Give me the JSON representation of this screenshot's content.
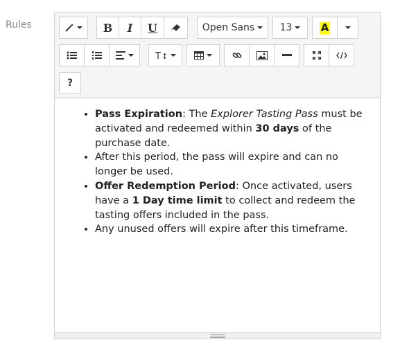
{
  "field": {
    "label": "Rules"
  },
  "toolbar": {
    "font_family": "Open Sans",
    "font_size": "13",
    "forecolor_label": "A",
    "help_label": "?",
    "colors": {
      "highlight": "#ffff00"
    }
  },
  "content": {
    "items": [
      {
        "b1": "Pass Expiration",
        "t1": ": The ",
        "i1": "Explorer Tasting Pass",
        "t2": " must be activated and redeemed within ",
        "b2": "30 days",
        "t3": " of the purchase date."
      },
      {
        "t1": "After this period, the pass will expire and can no longer be used."
      },
      {
        "b1": "Offer Redemption Period",
        "t1": ": Once activated, users have a ",
        "b2": "1 Day time limit",
        "t2": " to collect and redeem the tasting offers included in the pass."
      },
      {
        "t1": "Any unused offers will expire after this timeframe."
      }
    ]
  }
}
